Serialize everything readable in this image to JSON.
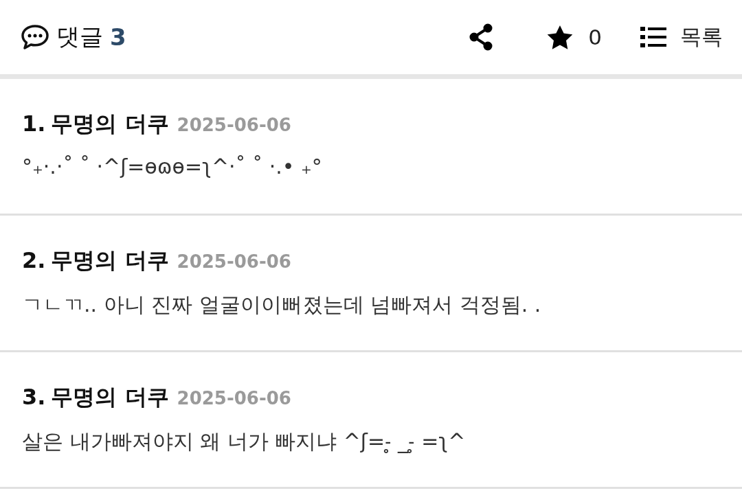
{
  "header": {
    "title": "댓글",
    "count": "3",
    "likes": "0",
    "list_label": "목록"
  },
  "comments": [
    {
      "number": "1.",
      "author": "무명의 더쿠",
      "date": "2025-06-06",
      "text": "°₊·.·˚ ˚ ·^ʃ=ɵɷɵ=ʅ^·˚ ˚ ·.• ₊°"
    },
    {
      "number": "2.",
      "author": "무명의 더쿠",
      "date": "2025-06-06",
      "text": "ㄱㄴㄲ.. 아니 진짜 얼굴이이뻐졌는데 넘빠져서 걱정됨. ."
    },
    {
      "number": "3.",
      "author": "무명의 더쿠",
      "date": "2025-06-06",
      "text": "살은 내가빠져야지 왜 너가 빠지냐 ^ʃ=˗̥ _˗̥ =ʅ^"
    }
  ]
}
